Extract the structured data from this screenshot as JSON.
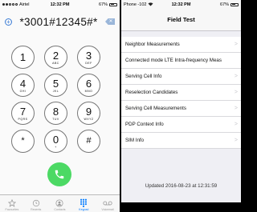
{
  "left": {
    "status": {
      "carrier": "Airtel",
      "time": "12:32 PM",
      "battery": "67%"
    },
    "dialed_number": "*3001#12345#*",
    "keys": [
      {
        "digit": "1",
        "letters": ""
      },
      {
        "digit": "2",
        "letters": "ABC"
      },
      {
        "digit": "3",
        "letters": "DEF"
      },
      {
        "digit": "4",
        "letters": "GHI"
      },
      {
        "digit": "5",
        "letters": "JKL"
      },
      {
        "digit": "6",
        "letters": "MNO"
      },
      {
        "digit": "7",
        "letters": "PQRS"
      },
      {
        "digit": "8",
        "letters": "TUV"
      },
      {
        "digit": "9",
        "letters": "WXYZ"
      },
      {
        "digit": "*",
        "letters": ""
      },
      {
        "digit": "0",
        "letters": "+"
      },
      {
        "digit": "#",
        "letters": ""
      }
    ],
    "tabs": [
      {
        "label": "Favourites",
        "icon": "star-icon"
      },
      {
        "label": "Recents",
        "icon": "clock-icon"
      },
      {
        "label": "Contacts",
        "icon": "person-icon"
      },
      {
        "label": "Keypad",
        "icon": "keypad-icon",
        "active": true
      },
      {
        "label": "Voicemail",
        "icon": "voicemail-icon"
      }
    ],
    "colors": {
      "call": "#4cd964",
      "accent": "#007aff"
    }
  },
  "right": {
    "status": {
      "signal": "Phone -102",
      "time": "12:32 PM",
      "battery": "67%"
    },
    "title": "Field Test",
    "menu": [
      "Neighbor Measurements",
      "Connected mode LTE Intra-frequency Meas",
      "Serving Cell Info",
      "Reselection Candidates",
      "Serving Cell Measurements",
      "PDP Context Info",
      "SIM Info"
    ],
    "updated": "Updated 2016-08-23 at 12:31:59"
  }
}
